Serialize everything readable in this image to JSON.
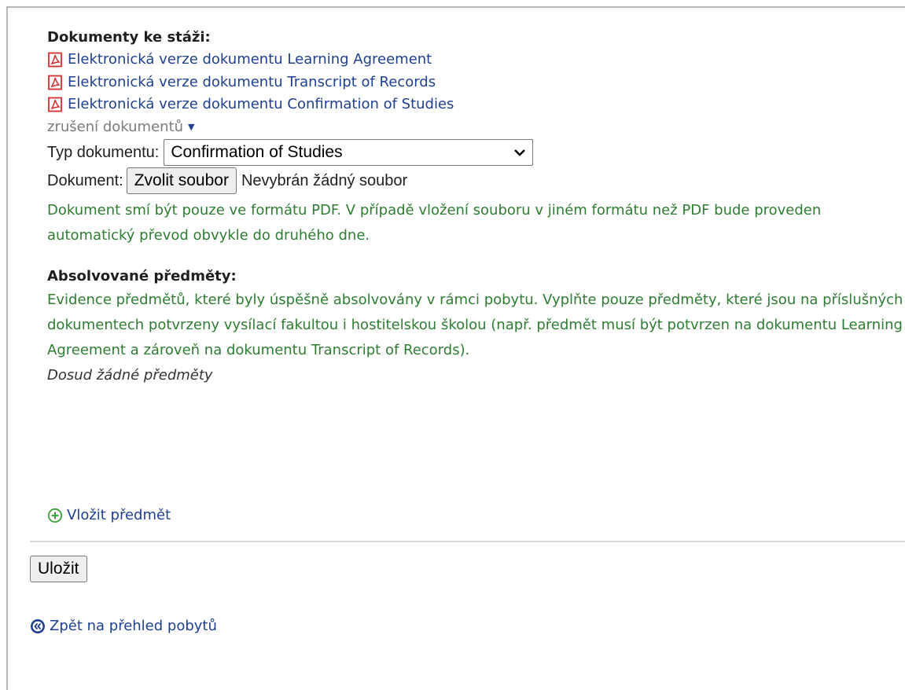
{
  "documents": {
    "heading": "Dokumenty ke stáži:",
    "links": [
      {
        "label": "Elektronická verze dokumentu Learning Agreement"
      },
      {
        "label": "Elektronická verze dokumentu Transcript of Records"
      },
      {
        "label": "Elektronická verze dokumentu Confirmation of Studies"
      }
    ],
    "cancel_toggle": "zrušení dokumentů",
    "type_label": "Typ dokumentu:",
    "type_selected": "Confirmation of Studies",
    "file_label": "Dokument:",
    "file_button": "Zvolit soubor",
    "file_status": "Nevybrán žádný soubor",
    "help": "Dokument smí být pouze ve formátu PDF. V případě vložení souboru v jiném formátu než PDF bude proveden automatický převod obvykle do druhého dne."
  },
  "subjects": {
    "heading": "Absolvované předměty:",
    "help": "Evidence předmětů, které byly úspěšně absolvovány v rámci pobytu. Vyplňte pouze předměty, které jsou na příslušných dokumentech potvrzeny vysílací fakultou i hostitelskou školou (např. předmět musí být potvrzen na dokumentu Learning Agreement a zároveň na dokumentu Transcript of Records).",
    "empty": "Dosud žádné předměty",
    "add_label": "Vložit předmět"
  },
  "actions": {
    "save_label": "Uložit",
    "back_label": "Zpět na přehled pobytů"
  },
  "icons": {
    "pdf": "pdf-file-icon",
    "add": "plus-circle-icon",
    "back": "double-chevron-left-icon",
    "caret": "caret-down-icon",
    "select": "chevron-down-icon"
  },
  "colors": {
    "link": "#1f3f8f",
    "help": "#2e7d32",
    "pdf_red": "#d32f2f",
    "add_green": "#3aa03a"
  }
}
